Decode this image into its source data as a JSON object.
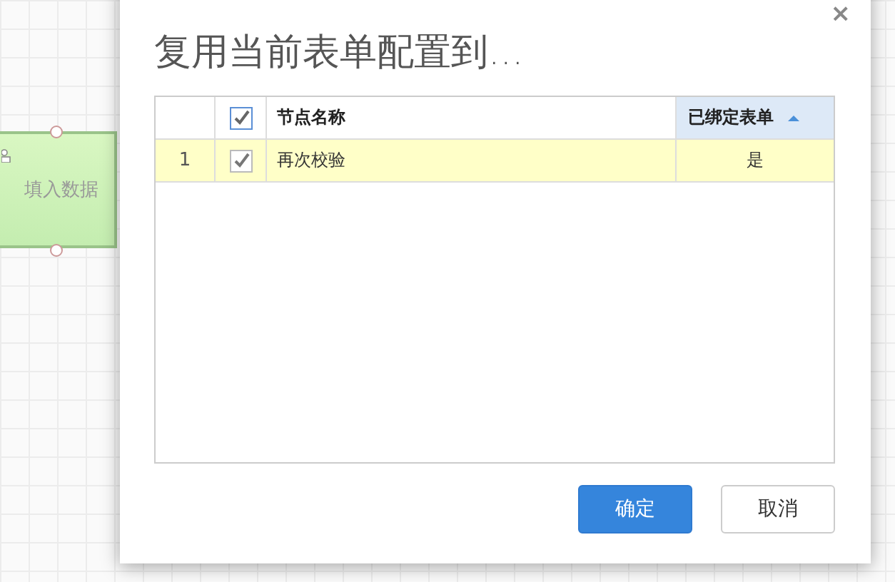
{
  "canvas": {
    "node": {
      "label": "填入数据"
    }
  },
  "dialog": {
    "title": "复用当前表单配置到...",
    "close": "×",
    "table": {
      "header_checked": true,
      "columns": [
        {
          "label": "节点名称",
          "sorted": false
        },
        {
          "label": "已绑定表单",
          "sorted": true
        }
      ],
      "rows": [
        {
          "index": "1",
          "checked": true,
          "selected": true,
          "name": "再次校验",
          "bound": "是"
        }
      ]
    },
    "buttons": [
      {
        "label": "确定",
        "kind": "primary"
      },
      {
        "label": "取消",
        "kind": "secondary"
      }
    ]
  }
}
